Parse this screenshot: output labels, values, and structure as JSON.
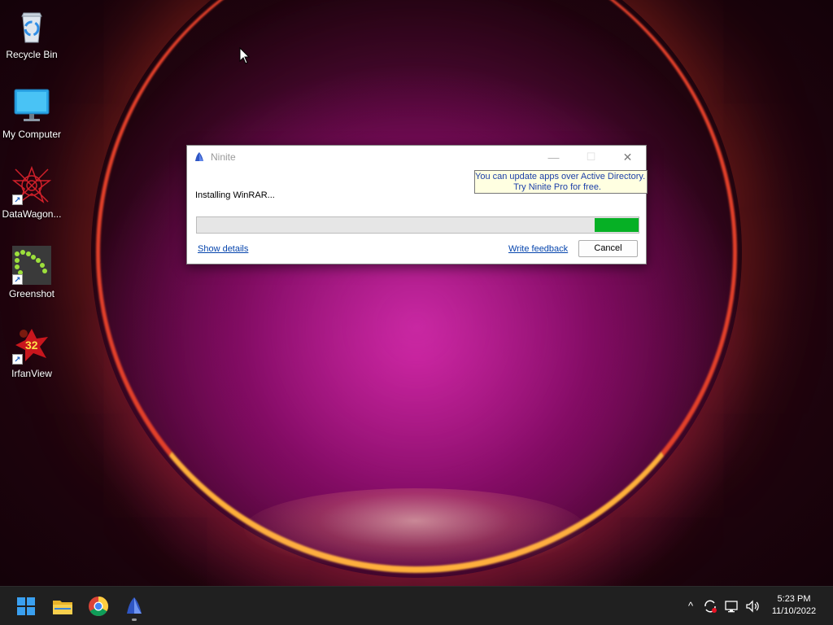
{
  "desktop": {
    "icons": [
      {
        "label": "Recycle Bin",
        "icon": "recycle-bin-icon"
      },
      {
        "label": "My Computer",
        "icon": "monitor-icon"
      },
      {
        "label": "DataWagon...",
        "icon": "datawagon-icon",
        "shortcut": true
      },
      {
        "label": "Greenshot",
        "icon": "greenshot-icon",
        "shortcut": true
      },
      {
        "label": "IrfanView",
        "icon": "irfanview-icon",
        "shortcut": true,
        "badge": "32"
      }
    ]
  },
  "window": {
    "title": "Ninite",
    "minimize_glyph": "—",
    "maximize_glyph": "☐",
    "close_glyph": "✕",
    "ad_line1": "You can update apps over Active Directory.",
    "ad_line2": "Try Ninite Pro for free.",
    "status": "Installing WinRAR...",
    "progress": 0.1,
    "show_details": "Show details",
    "write_feedback": "Write feedback",
    "cancel": "Cancel"
  },
  "taskbar": {
    "pinned": [
      "start-icon",
      "file-explorer-icon",
      "chrome-icon",
      "ninite-icon"
    ],
    "tray": {
      "chevron": "^",
      "time": "5:23 PM",
      "date": "11/10/2022"
    }
  },
  "colors": {
    "progress_fill": "#06b025",
    "link": "#0645ad",
    "ad_background": "#ffffe1",
    "ad_text": "#1b3ea8",
    "taskbar": "#202020"
  }
}
